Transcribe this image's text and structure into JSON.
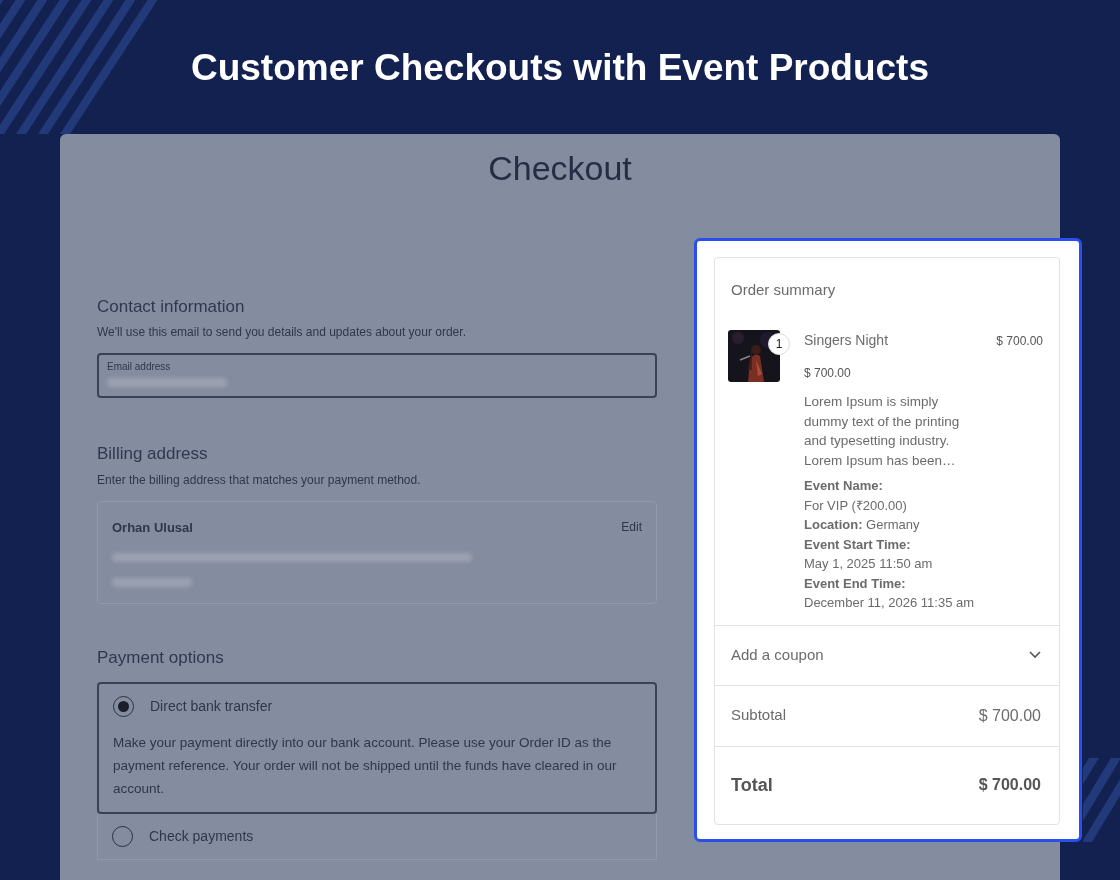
{
  "banner": {
    "title": "Customer Checkouts with Event Products"
  },
  "checkout": {
    "title": "Checkout",
    "contact": {
      "heading": "Contact information",
      "description": "We'll use this email to send you details and updates about your order.",
      "email_field": {
        "label": "Email address"
      }
    },
    "billing": {
      "heading": "Billing address",
      "description": "Enter the billing address that matches your payment method.",
      "name": "Orhan Ulusal",
      "edit": "Edit"
    },
    "payment": {
      "heading": "Payment options",
      "options": [
        {
          "label": "Direct bank transfer",
          "selected": true,
          "description": "Make your payment directly into our bank account. Please use your Order ID as the payment reference. Your order will not be shipped until the funds have cleared in our account."
        },
        {
          "label": "Check payments",
          "selected": false
        }
      ]
    }
  },
  "order_summary": {
    "title": "Order summary",
    "items": [
      {
        "quantity": "1",
        "name": "Singers Night",
        "line_total": "$ 700.00",
        "unit_price": "$ 700.00",
        "description": "Lorem Ipsum is simply dummy text of the printing and typesetting industry. Lorem Ipsum has been…",
        "details": [
          "**Event Name:**",
          "For VIP (₹200.00)",
          "**Location:** Germany",
          "**Event Start Time:**",
          "May 1, 2025 11:50 am",
          "**Event End Time:**",
          "December 11, 2026 11:35 am"
        ]
      }
    ],
    "coupon": {
      "label": "Add a coupon",
      "expanded": false
    },
    "subtotal": {
      "label": "Subtotal",
      "value": "$ 700.00"
    },
    "total": {
      "label": "Total",
      "value": "$ 700.00"
    }
  }
}
